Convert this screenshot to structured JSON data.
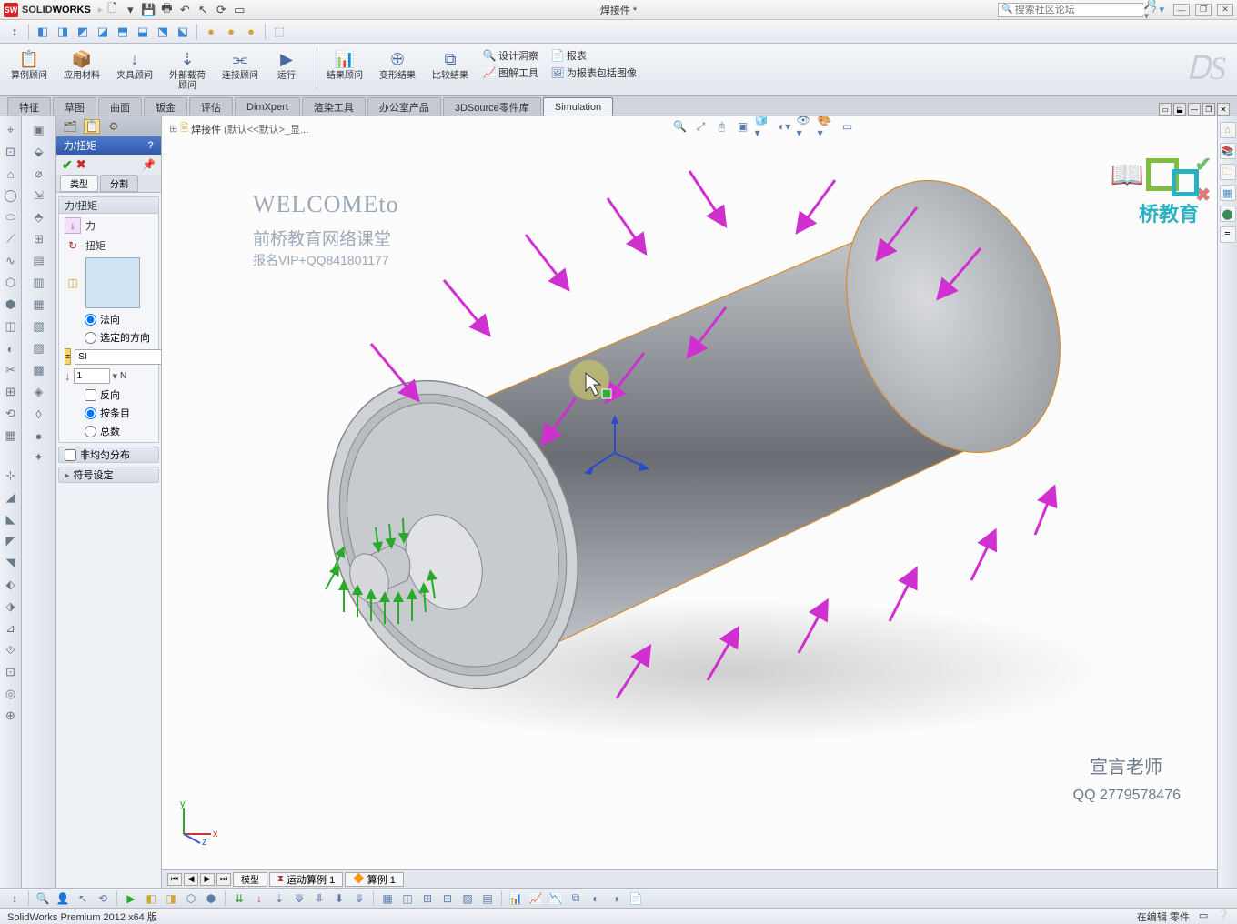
{
  "app": {
    "brand_a": "SOLID",
    "brand_b": "WORKS",
    "doc_title": "焊接件 *",
    "search_placeholder": "搜索社区论坛"
  },
  "ribbon": {
    "g1": "算例顾问",
    "g2": "应用材料",
    "g3": "夹具顾问",
    "g4": "外部载荷顾问",
    "g5": "连接顾问",
    "g6": "运行",
    "g7": "结果顾问",
    "g8": "变形结果",
    "g9": "比较结果",
    "s1": "设计洞察",
    "s2": "图解工具",
    "s3": "报表",
    "s4": "为报表包括图像"
  },
  "tabs": {
    "t1": "特征",
    "t2": "草图",
    "t3": "曲面",
    "t4": "钣金",
    "t5": "评估",
    "t6": "DimXpert",
    "t7": "渲染工具",
    "t8": "办公室产品",
    "t9": "3DSource零件库",
    "t10": "Simulation"
  },
  "pm": {
    "title": "力/扭矩",
    "tab1": "类型",
    "tab2": "分割",
    "sec1": "力/扭矩",
    "opt_force": "力",
    "opt_torque": "扭矩",
    "dir_normal": "法向",
    "dir_selected": "选定的方向",
    "unit_label": "SI",
    "force_value": "1",
    "force_unit": "N",
    "reverse": "反向",
    "per_item": "按条目",
    "total": "总数",
    "sec2": "非均匀分布",
    "sec3": "符号设定"
  },
  "breadcrumb": {
    "root": "焊接件",
    "cfg": "(默认<<默认>_显..."
  },
  "overlay": {
    "welcome": "WELCOMEto",
    "line2": "前桥教育网络课堂",
    "line3": "报名VIP+QQ841801177",
    "brand": "桥教育",
    "sig1": "宣言老师",
    "sig2": "QQ 2779578476"
  },
  "gfx_tabs": {
    "t1": "模型",
    "t2": "运动算例 1",
    "t3": "算例 1"
  },
  "status": {
    "left": "SolidWorks Premium 2012 x64 版",
    "right": "在编辑 零件"
  },
  "triad": {
    "x": "x",
    "y": "y",
    "z": "z"
  }
}
